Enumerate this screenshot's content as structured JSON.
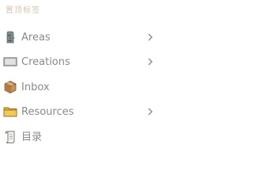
{
  "sidebar": {
    "header": "置顶标签",
    "items": [
      {
        "label": "Areas",
        "icon": "moai-icon",
        "has_chevron": true
      },
      {
        "label": "Creations",
        "icon": "screen-icon",
        "has_chevron": true
      },
      {
        "label": "Inbox",
        "icon": "package-icon",
        "has_chevron": false
      },
      {
        "label": "Resources",
        "icon": "folder-icon",
        "has_chevron": true
      },
      {
        "label": "目录",
        "icon": "scroll-icon",
        "has_chevron": false
      }
    ]
  },
  "colors": {
    "header_text": "#d6c6b2",
    "item_text": "#8a8a8a",
    "chevron": "#8a8a8a"
  }
}
